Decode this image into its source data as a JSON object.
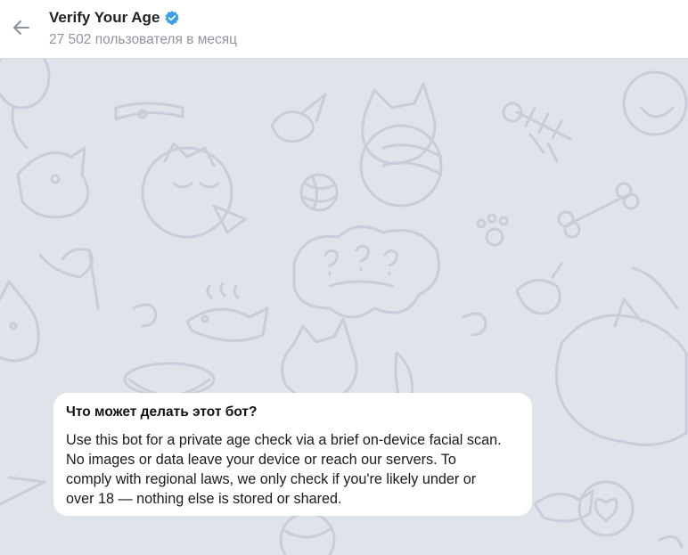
{
  "header": {
    "back_icon": "arrow-left-icon",
    "title": "Verify Your Age",
    "verified_icon": "verified-badge-icon",
    "subtitle": "27 502 пользователя в месяц"
  },
  "chat": {
    "background_pattern": "doodle-pattern",
    "info_card": {
      "title": "Что может делать этот бот?",
      "text": "Use this bot for a private age check via a brief on-device facial scan.\nNo images or data leave your device or reach our servers. To\ncomply with regional laws, we only check if you're likely under or\nover 18 — nothing else is stored or shared."
    }
  },
  "colors": {
    "header_bg": "#ffffff",
    "chat_bg": "#dfe3ea",
    "verified_blue": "#3c9ee6",
    "subtitle": "#8d949c"
  }
}
